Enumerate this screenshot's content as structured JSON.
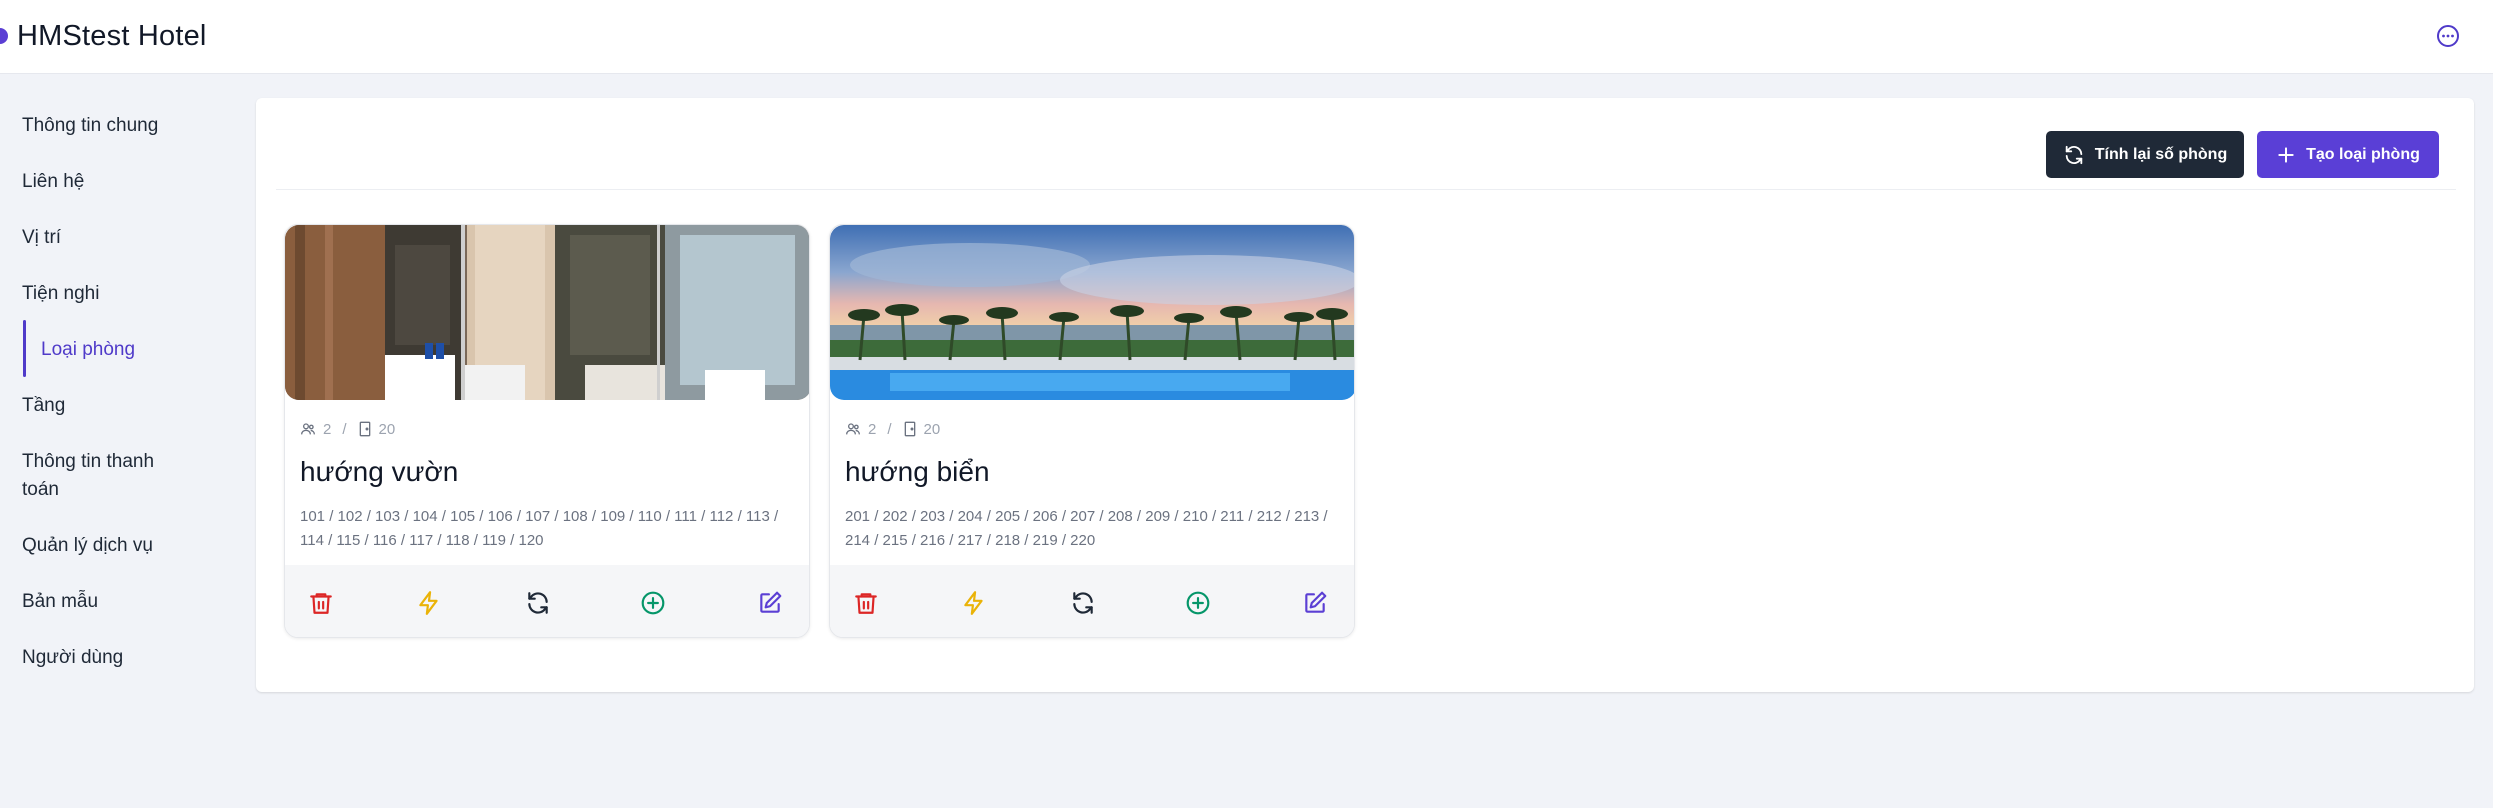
{
  "header": {
    "title": "HMStest Hotel"
  },
  "sidebar": {
    "items": [
      {
        "label": "Thông tin chung"
      },
      {
        "label": "Liên hệ"
      },
      {
        "label": "Vị trí"
      },
      {
        "label": "Tiện nghi"
      },
      {
        "label": "Loại phòng"
      },
      {
        "label": "Tầng"
      },
      {
        "label": "Thông tin thanh toán"
      },
      {
        "label": "Quản lý dịch vụ"
      },
      {
        "label": "Bản mẫu"
      },
      {
        "label": "Người dùng"
      }
    ],
    "active": "Loại phòng"
  },
  "toolbar": {
    "recalc_label": "Tính lại số phòng",
    "create_label": "Tạo loại phòng"
  },
  "room_types": [
    {
      "name": "hướng vườn",
      "guests": "2",
      "separator": "/",
      "rooms_count": "20",
      "rooms": "101 / 102 / 103 / 104 / 105 / 106 / 107 / 108 / 109 / 110 / 111 / 112 / 113 / 114 / 115 / 116 / 117 / 118 / 119 / 120",
      "image": "bathroom-photo"
    },
    {
      "name": "hướng biển",
      "guests": "2",
      "separator": "/",
      "rooms_count": "20",
      "rooms": "201 / 202 / 203 / 204 / 205 / 206 / 207 / 208 / 209 / 210 / 211 / 212 / 213 / 214 / 215 / 216 / 217 / 218 / 219 / 220",
      "image": "beach-resort-photo"
    }
  ],
  "colors": {
    "accent": "#5a3fd6",
    "dark_button": "#1f2937",
    "delete": "#dc2626",
    "bolt": "#eab308",
    "add": "#059669",
    "edit": "#5b3fd4"
  },
  "icons": [
    "more-icon",
    "refresh-icon",
    "plus-icon",
    "users-icon",
    "door-icon",
    "trash-icon",
    "bolt-icon",
    "refresh-icon",
    "plus-circle-icon",
    "edit-icon"
  ]
}
